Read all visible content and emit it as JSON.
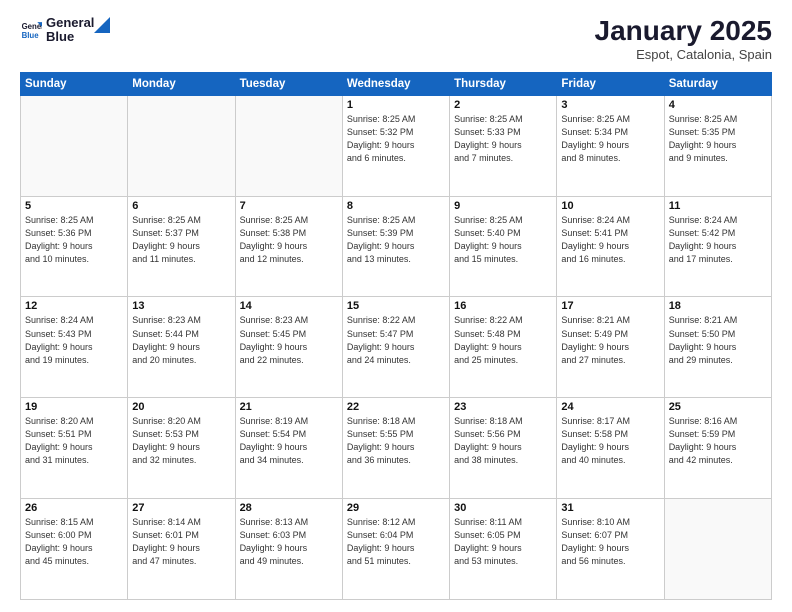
{
  "header": {
    "logo_line1": "General",
    "logo_line2": "Blue",
    "month": "January 2025",
    "location": "Espot, Catalonia, Spain"
  },
  "days_of_week": [
    "Sunday",
    "Monday",
    "Tuesday",
    "Wednesday",
    "Thursday",
    "Friday",
    "Saturday"
  ],
  "weeks": [
    [
      {
        "day": "",
        "info": "",
        "empty": true
      },
      {
        "day": "",
        "info": "",
        "empty": true
      },
      {
        "day": "",
        "info": "",
        "empty": true
      },
      {
        "day": "1",
        "info": "Sunrise: 8:25 AM\nSunset: 5:32 PM\nDaylight: 9 hours\nand 6 minutes."
      },
      {
        "day": "2",
        "info": "Sunrise: 8:25 AM\nSunset: 5:33 PM\nDaylight: 9 hours\nand 7 minutes."
      },
      {
        "day": "3",
        "info": "Sunrise: 8:25 AM\nSunset: 5:34 PM\nDaylight: 9 hours\nand 8 minutes."
      },
      {
        "day": "4",
        "info": "Sunrise: 8:25 AM\nSunset: 5:35 PM\nDaylight: 9 hours\nand 9 minutes."
      }
    ],
    [
      {
        "day": "5",
        "info": "Sunrise: 8:25 AM\nSunset: 5:36 PM\nDaylight: 9 hours\nand 10 minutes."
      },
      {
        "day": "6",
        "info": "Sunrise: 8:25 AM\nSunset: 5:37 PM\nDaylight: 9 hours\nand 11 minutes."
      },
      {
        "day": "7",
        "info": "Sunrise: 8:25 AM\nSunset: 5:38 PM\nDaylight: 9 hours\nand 12 minutes."
      },
      {
        "day": "8",
        "info": "Sunrise: 8:25 AM\nSunset: 5:39 PM\nDaylight: 9 hours\nand 13 minutes."
      },
      {
        "day": "9",
        "info": "Sunrise: 8:25 AM\nSunset: 5:40 PM\nDaylight: 9 hours\nand 15 minutes."
      },
      {
        "day": "10",
        "info": "Sunrise: 8:24 AM\nSunset: 5:41 PM\nDaylight: 9 hours\nand 16 minutes."
      },
      {
        "day": "11",
        "info": "Sunrise: 8:24 AM\nSunset: 5:42 PM\nDaylight: 9 hours\nand 17 minutes."
      }
    ],
    [
      {
        "day": "12",
        "info": "Sunrise: 8:24 AM\nSunset: 5:43 PM\nDaylight: 9 hours\nand 19 minutes."
      },
      {
        "day": "13",
        "info": "Sunrise: 8:23 AM\nSunset: 5:44 PM\nDaylight: 9 hours\nand 20 minutes."
      },
      {
        "day": "14",
        "info": "Sunrise: 8:23 AM\nSunset: 5:45 PM\nDaylight: 9 hours\nand 22 minutes."
      },
      {
        "day": "15",
        "info": "Sunrise: 8:22 AM\nSunset: 5:47 PM\nDaylight: 9 hours\nand 24 minutes."
      },
      {
        "day": "16",
        "info": "Sunrise: 8:22 AM\nSunset: 5:48 PM\nDaylight: 9 hours\nand 25 minutes."
      },
      {
        "day": "17",
        "info": "Sunrise: 8:21 AM\nSunset: 5:49 PM\nDaylight: 9 hours\nand 27 minutes."
      },
      {
        "day": "18",
        "info": "Sunrise: 8:21 AM\nSunset: 5:50 PM\nDaylight: 9 hours\nand 29 minutes."
      }
    ],
    [
      {
        "day": "19",
        "info": "Sunrise: 8:20 AM\nSunset: 5:51 PM\nDaylight: 9 hours\nand 31 minutes."
      },
      {
        "day": "20",
        "info": "Sunrise: 8:20 AM\nSunset: 5:53 PM\nDaylight: 9 hours\nand 32 minutes."
      },
      {
        "day": "21",
        "info": "Sunrise: 8:19 AM\nSunset: 5:54 PM\nDaylight: 9 hours\nand 34 minutes."
      },
      {
        "day": "22",
        "info": "Sunrise: 8:18 AM\nSunset: 5:55 PM\nDaylight: 9 hours\nand 36 minutes."
      },
      {
        "day": "23",
        "info": "Sunrise: 8:18 AM\nSunset: 5:56 PM\nDaylight: 9 hours\nand 38 minutes."
      },
      {
        "day": "24",
        "info": "Sunrise: 8:17 AM\nSunset: 5:58 PM\nDaylight: 9 hours\nand 40 minutes."
      },
      {
        "day": "25",
        "info": "Sunrise: 8:16 AM\nSunset: 5:59 PM\nDaylight: 9 hours\nand 42 minutes."
      }
    ],
    [
      {
        "day": "26",
        "info": "Sunrise: 8:15 AM\nSunset: 6:00 PM\nDaylight: 9 hours\nand 45 minutes."
      },
      {
        "day": "27",
        "info": "Sunrise: 8:14 AM\nSunset: 6:01 PM\nDaylight: 9 hours\nand 47 minutes."
      },
      {
        "day": "28",
        "info": "Sunrise: 8:13 AM\nSunset: 6:03 PM\nDaylight: 9 hours\nand 49 minutes."
      },
      {
        "day": "29",
        "info": "Sunrise: 8:12 AM\nSunset: 6:04 PM\nDaylight: 9 hours\nand 51 minutes."
      },
      {
        "day": "30",
        "info": "Sunrise: 8:11 AM\nSunset: 6:05 PM\nDaylight: 9 hours\nand 53 minutes."
      },
      {
        "day": "31",
        "info": "Sunrise: 8:10 AM\nSunset: 6:07 PM\nDaylight: 9 hours\nand 56 minutes."
      },
      {
        "day": "",
        "info": "",
        "empty": true
      }
    ]
  ]
}
